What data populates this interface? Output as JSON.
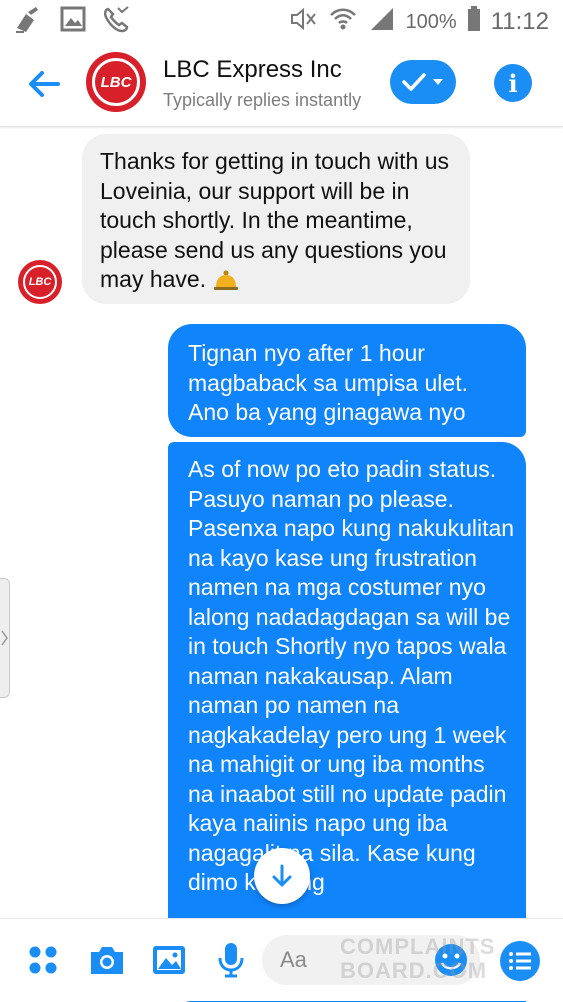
{
  "status_bar": {
    "battery": "100%",
    "time": "11:12",
    "left_icons": [
      "cleaner-icon",
      "gallery-icon",
      "missed-call-icon"
    ],
    "right_icons": [
      "mute-icon",
      "wifi-icon",
      "signal-icon",
      "battery-icon"
    ]
  },
  "header": {
    "contact_name": "LBC Express Inc",
    "subtitle": "Typically replies instantly",
    "avatar_text": "LBC",
    "accent": "#1a8ef5",
    "brand_red": "#d8202a"
  },
  "messages": [
    {
      "direction": "incoming",
      "text": "Thanks for getting in touch with us Loveinia, our support will be in touch shortly. In the meantime, please send us any questions you may have.",
      "emoji": "bell-icon"
    },
    {
      "direction": "outgoing",
      "text": "Tignan nyo after 1 hour magbaback sa umpisa ulet. Ano ba yang ginagawa nyo"
    },
    {
      "direction": "outgoing",
      "text": "As of now po eto padin status. Pasuyo naman po please. Pasenxa napo kung nakukulitan na kayo kase ung frustration namen na mga costumer nyo lalong nadadagdagan sa will be in touch Shortly nyo tapos wala naman nakakausap. Alam naman po namen na nagkakadelay pero ung 1 week na mahigit or ung iba months na inaabot still no update padin kaya naiinis napo ung iba nagagalit na sila. Kase kung dimo kaya ng"
    }
  ],
  "composer": {
    "placeholder": "Aa",
    "icons": [
      "apps-icon",
      "camera-icon",
      "image-icon",
      "microphone-icon",
      "emoji-icon",
      "menu-icon"
    ]
  },
  "watermark": {
    "line1": "COMPLAINTS",
    "line2": "BOARD.COM"
  },
  "colors": {
    "outgoing_bubble": "#0f84fb",
    "incoming_bubble": "#f0f0f0"
  }
}
